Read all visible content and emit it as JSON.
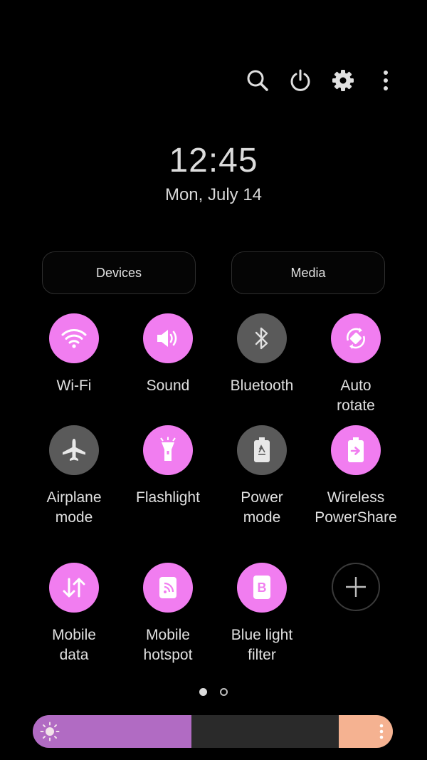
{
  "clock": {
    "time": "12:45",
    "date": "Mon, July 14"
  },
  "top_actions": [
    {
      "name": "search-icon"
    },
    {
      "name": "power-icon"
    },
    {
      "name": "settings-icon"
    },
    {
      "name": "more-options-icon"
    }
  ],
  "pills": {
    "devices": "Devices",
    "media": "Media"
  },
  "tiles": [
    {
      "label": "Wi-Fi",
      "state": "on",
      "icon": "wifi-icon"
    },
    {
      "label": "Sound",
      "state": "on",
      "icon": "sound-icon"
    },
    {
      "label": "Bluetooth",
      "state": "off",
      "icon": "bluetooth-icon"
    },
    {
      "label": "Auto\nrotate",
      "state": "on",
      "icon": "auto-rotate-icon"
    },
    {
      "label": "Airplane\nmode",
      "state": "off",
      "icon": "airplane-icon"
    },
    {
      "label": "Flashlight",
      "state": "on",
      "icon": "flashlight-icon"
    },
    {
      "label": "Power\nmode",
      "state": "off",
      "icon": "power-mode-icon"
    },
    {
      "label": "Wireless\nPowerShare",
      "state": "on",
      "icon": "wireless-powershare-icon"
    },
    {
      "label": "Mobile\ndata",
      "state": "on",
      "icon": "mobile-data-icon"
    },
    {
      "label": "Mobile\nhotspot",
      "state": "on",
      "icon": "mobile-hotspot-icon"
    },
    {
      "label": "Blue light\nfilter",
      "state": "on",
      "icon": "blue-light-filter-icon"
    }
  ],
  "pager": {
    "pages": 2,
    "current": 1
  },
  "brightness": {
    "level": 0.44
  },
  "colors": {
    "accent": "#f17df0",
    "off_tile": "#5a5a5a",
    "brightness_fill": "#b16bc3",
    "brightness_end": "#f5b291"
  }
}
